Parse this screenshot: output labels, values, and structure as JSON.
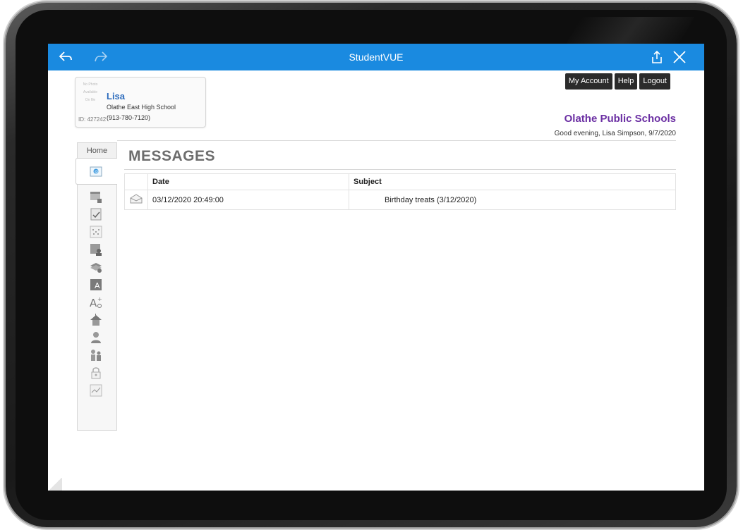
{
  "app": {
    "title": "StudentVUE"
  },
  "nav": {
    "back_icon": "back-arrow-icon",
    "forward_icon": "forward-arrow-icon",
    "share_icon": "share-icon",
    "close_icon": "close-icon"
  },
  "profile": {
    "photo_text": [
      "No Photo",
      "Available",
      "On file"
    ],
    "id_label": "ID: 427242",
    "name": "Lisa",
    "school": "Olathe East High School",
    "phone": "(913-780-7120)"
  },
  "header": {
    "buttons": [
      "My Account",
      "Help",
      "Logout"
    ],
    "district": "Olathe Public Schools",
    "greeting": "Good evening, Lisa Simpson, 9/7/2020"
  },
  "sidebar": {
    "home_label": "Home",
    "items": [
      "messages-icon",
      "calendar-icon",
      "attendance-icon",
      "class-schedule-icon",
      "course-history-icon",
      "report-card-icon",
      "grade-book-icon",
      "test-scores-icon",
      "school-information-icon",
      "student-info-icon",
      "parent-icon",
      "security-icon",
      "progress-report-icon"
    ]
  },
  "page": {
    "title": "MESSAGES"
  },
  "messages": {
    "columns": [
      "",
      "Date",
      "Subject"
    ],
    "rows": [
      {
        "icon": "envelope-open-icon",
        "date": "03/12/2020 20:49:00",
        "subject": "Birthday treats (3/12/2020)"
      }
    ]
  },
  "colors": {
    "navbar": "#1a8ae0",
    "district": "#6b2fa3",
    "name": "#2d6cbd"
  }
}
